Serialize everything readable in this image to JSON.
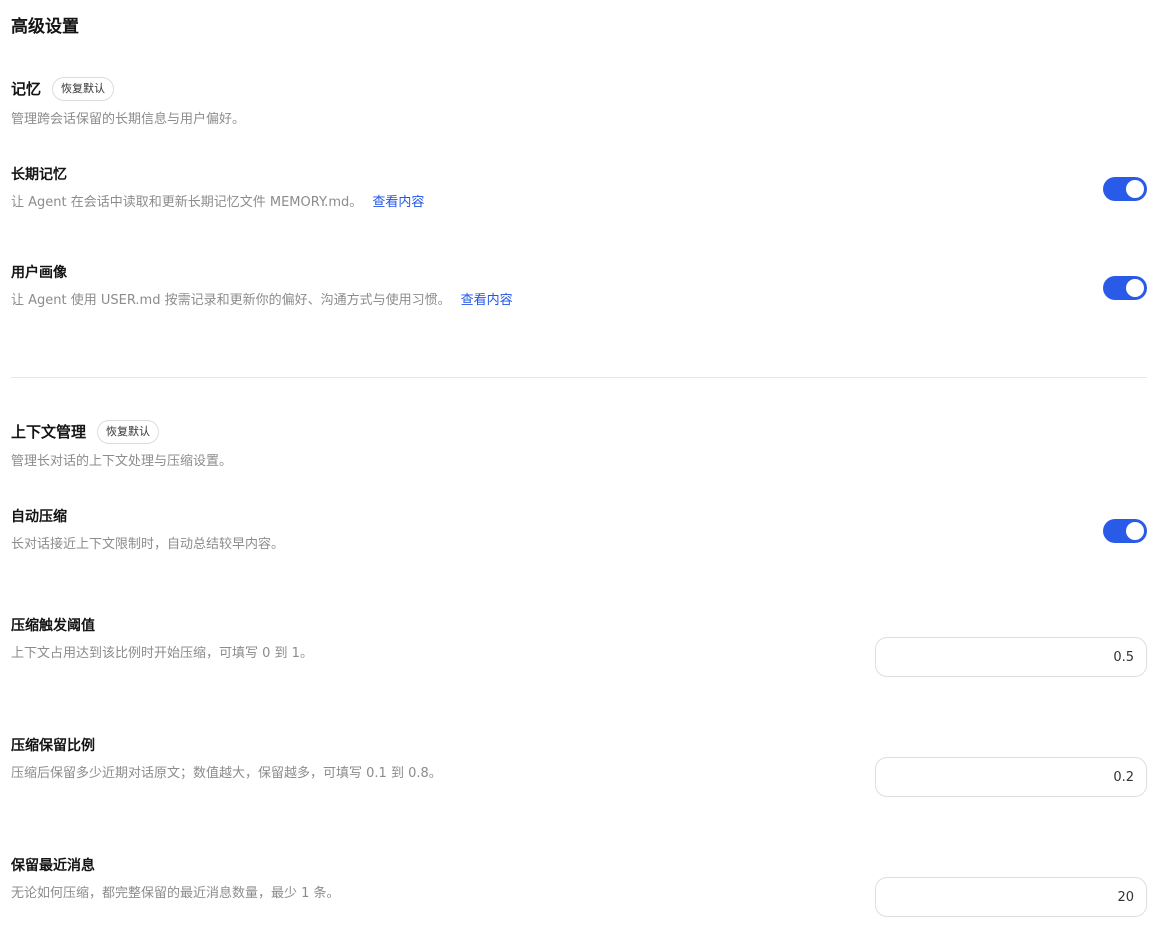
{
  "page": {
    "title": "高级设置"
  },
  "memory": {
    "title": "记忆",
    "reset_label": "恢复默认",
    "description": "管理跨会话保留的长期信息与用户偏好。",
    "long_term": {
      "title": "长期记忆",
      "description": "让 Agent 在会话中读取和更新长期记忆文件 MEMORY.md。",
      "link": "查看内容",
      "enabled": true
    },
    "user_profile": {
      "title": "用户画像",
      "description": "让 Agent 使用 USER.md 按需记录和更新你的偏好、沟通方式与使用习惯。",
      "link": "查看内容",
      "enabled": true
    }
  },
  "context": {
    "title": "上下文管理",
    "reset_label": "恢复默认",
    "description": "管理长对话的上下文处理与压缩设置。",
    "auto_compress": {
      "title": "自动压缩",
      "description": "长对话接近上下文限制时，自动总结较早内容。",
      "enabled": true
    },
    "threshold": {
      "title": "压缩触发阈值",
      "description": "上下文占用达到该比例时开始压缩，可填写 0 到 1。",
      "value": "0.5"
    },
    "retain_ratio": {
      "title": "压缩保留比例",
      "description": "压缩后保留多少近期对话原文；数值越大，保留越多，可填写 0.1 到 0.8。",
      "value": "0.2"
    },
    "recent_messages": {
      "title": "保留最近消息",
      "description": "无论如何压缩，都完整保留的最近消息数量，最少 1 条。",
      "value": "20"
    }
  },
  "colors": {
    "accent": "#2a5be8",
    "link": "#2255e8",
    "muted_text": "#8c8c8c"
  }
}
